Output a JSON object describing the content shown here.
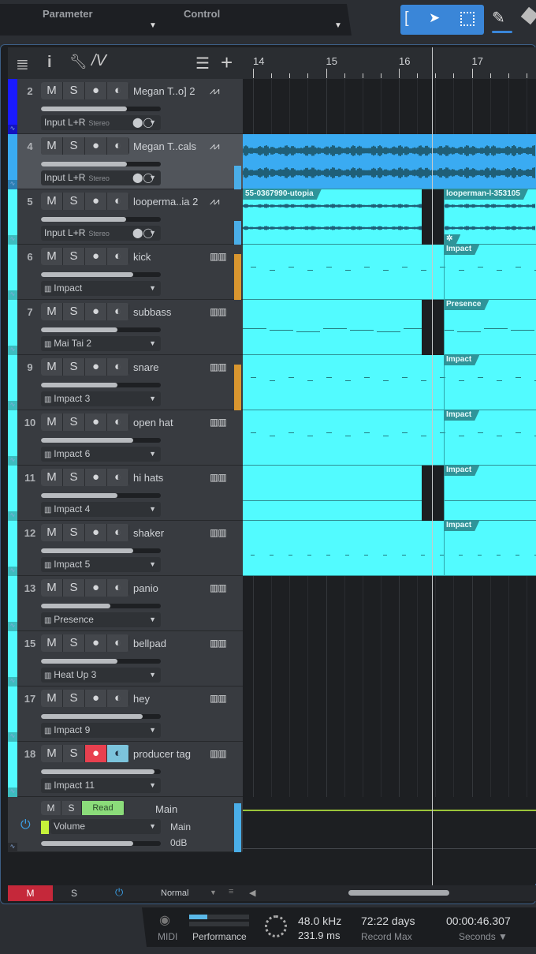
{
  "toolbar": {
    "parameter": "Parameter",
    "control": "Control",
    "icons": [
      "range-select-icon",
      "arrow-tool-icon",
      "split-select-icon",
      "pencil-tool-icon",
      "eraser-tool-icon"
    ]
  },
  "ruler": {
    "bars": [
      "14",
      "15",
      "16",
      "17"
    ]
  },
  "colors": {
    "accent": "#3a86d8",
    "cyan": "#52fbff",
    "blue": "#3aabf2",
    "deepblue": "#1a1aff",
    "record": "#e8404f"
  },
  "tracks": [
    {
      "num": "2",
      "name": "Megan T..o] 2",
      "type": "audio",
      "input": "Input L+R",
      "mode": "Stereo",
      "fader": 0.72,
      "color": "#1a1aff"
    },
    {
      "num": "4",
      "name": "Megan T..cals",
      "type": "audio",
      "input": "Input L+R",
      "mode": "Stereo",
      "fader": 0.72,
      "color": "#3aabf2",
      "selected": true
    },
    {
      "num": "5",
      "name": "looperma..ia 2",
      "type": "audio",
      "input": "Input L+R",
      "mode": "Stereo",
      "fader": 0.71,
      "color": "#52fbff"
    },
    {
      "num": "6",
      "name": "kick",
      "type": "instrument",
      "input": "Impact",
      "fader": 0.77,
      "color": "#52fbff"
    },
    {
      "num": "7",
      "name": "subbass",
      "type": "instrument",
      "input": "Mai Tai 2",
      "fader": 0.64,
      "color": "#52fbff"
    },
    {
      "num": "9",
      "name": "snare",
      "type": "instrument",
      "input": "Impact 3",
      "fader": 0.64,
      "color": "#52fbff"
    },
    {
      "num": "10",
      "name": "open hat",
      "type": "instrument",
      "input": "Impact 6",
      "fader": 0.77,
      "color": "#52fbff"
    },
    {
      "num": "11",
      "name": "hi hats",
      "type": "instrument",
      "input": "Impact 4",
      "fader": 0.64,
      "color": "#52fbff"
    },
    {
      "num": "12",
      "name": "shaker",
      "type": "instrument",
      "input": "Impact 5",
      "fader": 0.77,
      "color": "#52fbff"
    },
    {
      "num": "13",
      "name": "panio",
      "type": "instrument",
      "input": "Presence",
      "fader": 0.58,
      "color": "#52fbff"
    },
    {
      "num": "15",
      "name": "bellpad",
      "type": "instrument",
      "input": "Heat Up 3",
      "fader": 0.64,
      "color": "#52fbff"
    },
    {
      "num": "17",
      "name": "hey",
      "type": "instrument",
      "input": "Impact 9",
      "fader": 0.85,
      "color": "#52fbff"
    },
    {
      "num": "18",
      "name": "producer tag",
      "type": "instrument",
      "input": "Impact 11",
      "fader": 0.95,
      "color": "#52fbff",
      "record": true,
      "monitor": true
    }
  ],
  "button_labels": {
    "mute": "M",
    "solo": "S"
  },
  "clips": [
    {
      "lane": 1,
      "labels": []
    },
    {
      "lane": 2,
      "labels": [
        "55-0367990-utopia",
        "looperman-l-353105"
      ],
      "gap": true
    },
    {
      "lane": 3,
      "labels": [
        "",
        "Impact"
      ]
    },
    {
      "lane": 4,
      "labels": [
        "",
        "Presence"
      ],
      "gap": true
    },
    {
      "lane": 5,
      "labels": [
        "",
        "Impact"
      ]
    },
    {
      "lane": 6,
      "labels": [
        "",
        "Impact"
      ]
    },
    {
      "lane": 7,
      "labels": [
        "",
        "Impact"
      ],
      "gap": true
    },
    {
      "lane": 8,
      "labels": [
        "",
        "Impact"
      ]
    }
  ],
  "main": {
    "mute": "M",
    "solo": "S",
    "read": "Read",
    "name": "Main",
    "param": "Volume",
    "output": "Main",
    "level": "0dB",
    "fader": 0.77
  },
  "bottom": {
    "mute": "M",
    "solo": "S",
    "mode": "Normal"
  },
  "status": {
    "midi": "MIDI",
    "performance": "Performance",
    "performance_level": 0.3,
    "sample_rate": "48.0 kHz",
    "latency": "231.9 ms",
    "record_max": "72:22 days",
    "record_max_label": "Record Max",
    "time": "00:00:46.307",
    "time_format": "Seconds"
  }
}
